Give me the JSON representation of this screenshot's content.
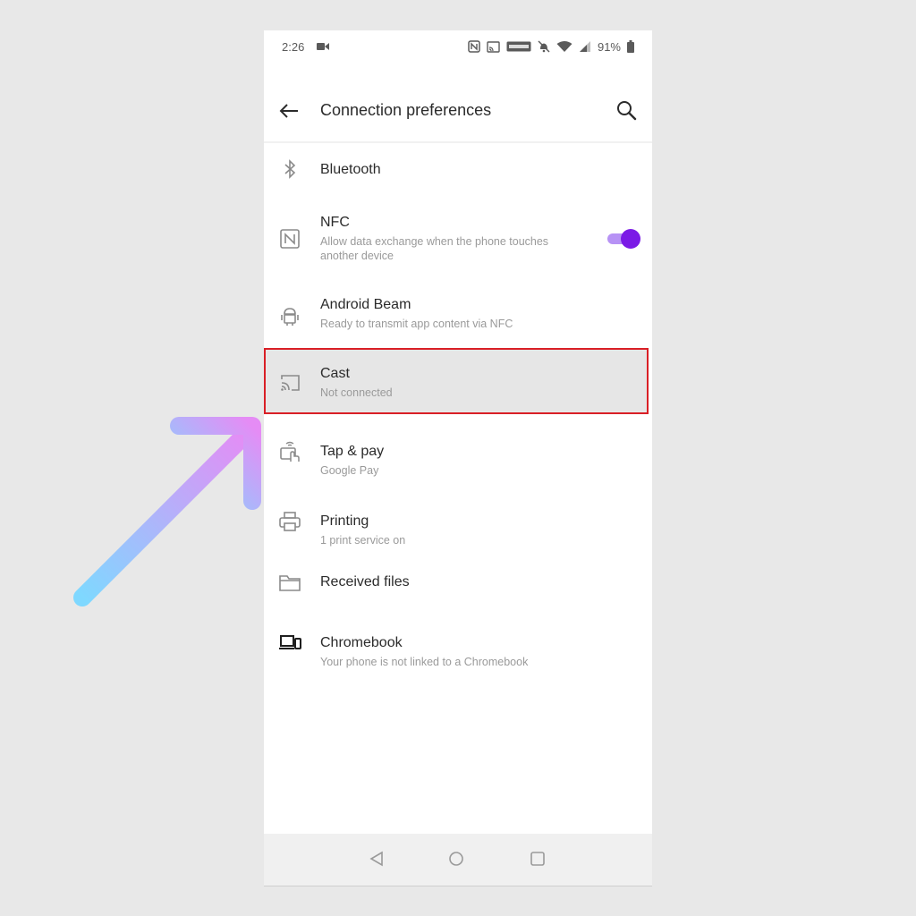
{
  "status_bar": {
    "time": "2:26",
    "battery": "91%"
  },
  "header": {
    "title": "Connection preferences",
    "back_icon": "arrow-left-icon",
    "search_icon": "search-icon"
  },
  "items": [
    {
      "title": "Bluetooth",
      "subtitle": "",
      "icon": "bluetooth-icon"
    },
    {
      "title": "NFC",
      "subtitle": "Allow data exchange when the phone touches another device",
      "icon": "nfc-icon",
      "toggle_on": true
    },
    {
      "title": "Android Beam",
      "subtitle": "Ready to transmit app content via NFC",
      "icon": "android-icon"
    },
    {
      "title": "Cast",
      "subtitle": "Not connected",
      "icon": "cast-icon",
      "highlighted": true
    },
    {
      "title": "Tap & pay",
      "subtitle": "Google Pay",
      "icon": "tap-pay-icon"
    },
    {
      "title": "Printing",
      "subtitle": "1 print service on",
      "icon": "printer-icon"
    },
    {
      "title": "Received files",
      "subtitle": "",
      "icon": "folder-icon"
    },
    {
      "title": "Chromebook",
      "subtitle": "Your phone is not linked to a Chromebook",
      "icon": "chromebook-icon"
    }
  ],
  "nav_bar": {
    "buttons": [
      "back-triangle-icon",
      "home-circle-icon",
      "recents-square-icon"
    ]
  },
  "colors": {
    "accent": "#7b1ae6",
    "highlight_border": "#d91f26",
    "arrow_start": "#7fd8ff",
    "arrow_end": "#e58cf5"
  }
}
